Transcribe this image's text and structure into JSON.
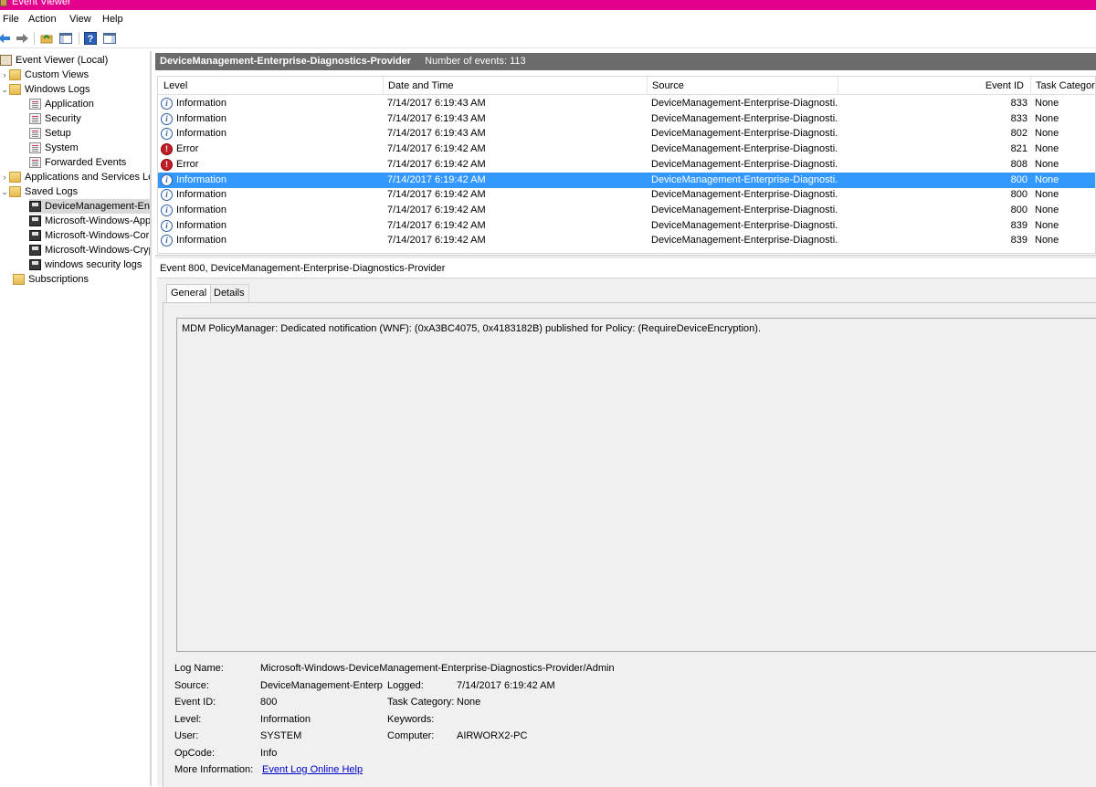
{
  "window": {
    "title": "Event Viewer"
  },
  "menu": [
    "File",
    "Action",
    "View",
    "Help"
  ],
  "toolbar": {
    "icons": [
      "back-arrow-icon",
      "forward-arrow-icon",
      "open-folder-icon",
      "show-hide-tree-icon",
      "help-icon",
      "show-action-pane-icon"
    ]
  },
  "tree": {
    "items": [
      {
        "label": "Event Viewer (Local)",
        "level": 0,
        "arrow": "",
        "icon": "root"
      },
      {
        "label": "Custom Views",
        "level": 0,
        "arrow": ">",
        "icon": "folder"
      },
      {
        "label": "Windows Logs",
        "level": 0,
        "arrow": "v",
        "icon": "folder"
      },
      {
        "label": "Application",
        "level": 1,
        "arrow": "",
        "icon": "log"
      },
      {
        "label": "Security",
        "level": 1,
        "arrow": "",
        "icon": "log"
      },
      {
        "label": "Setup",
        "level": 1,
        "arrow": "",
        "icon": "log"
      },
      {
        "label": "System",
        "level": 1,
        "arrow": "",
        "icon": "log"
      },
      {
        "label": "Forwarded Events",
        "level": 1,
        "arrow": "",
        "icon": "log"
      },
      {
        "label": "Applications and Services Lo",
        "level": 0,
        "arrow": ">",
        "icon": "folder"
      },
      {
        "label": "Saved Logs",
        "level": 0,
        "arrow": "v",
        "icon": "folder"
      },
      {
        "label": "DeviceManagement-Ente",
        "level": 1,
        "arrow": "",
        "icon": "saved",
        "selected": true
      },
      {
        "label": "Microsoft-Windows-App",
        "level": 1,
        "arrow": "",
        "icon": "saved"
      },
      {
        "label": "Microsoft-Windows-Cor",
        "level": 1,
        "arrow": "",
        "icon": "saved"
      },
      {
        "label": "Microsoft-Windows-Cryp",
        "level": 1,
        "arrow": "",
        "icon": "saved"
      },
      {
        "label": "windows security logs",
        "level": 1,
        "arrow": "",
        "icon": "saved"
      },
      {
        "label": "Subscriptions",
        "level": 0,
        "arrow": "",
        "icon": "sub"
      }
    ]
  },
  "log_header": {
    "title": "DeviceManagement-Enterprise-Diagnostics-Provider",
    "count": "Number of events: 113"
  },
  "grid": {
    "columns": [
      "Level",
      "Date and Time",
      "Source",
      "Event ID",
      "Task Category"
    ],
    "rows": [
      {
        "level": "Information",
        "type": "info",
        "date": "7/14/2017 6:19:43 AM",
        "source": "DeviceManagement-Enterprise-Diagnosti...",
        "id": "833",
        "cat": "None"
      },
      {
        "level": "Information",
        "type": "info",
        "date": "7/14/2017 6:19:43 AM",
        "source": "DeviceManagement-Enterprise-Diagnosti...",
        "id": "833",
        "cat": "None"
      },
      {
        "level": "Information",
        "type": "info",
        "date": "7/14/2017 6:19:43 AM",
        "source": "DeviceManagement-Enterprise-Diagnosti...",
        "id": "802",
        "cat": "None"
      },
      {
        "level": "Error",
        "type": "error",
        "date": "7/14/2017 6:19:42 AM",
        "source": "DeviceManagement-Enterprise-Diagnosti...",
        "id": "821",
        "cat": "None"
      },
      {
        "level": "Error",
        "type": "error",
        "date": "7/14/2017 6:19:42 AM",
        "source": "DeviceManagement-Enterprise-Diagnosti...",
        "id": "808",
        "cat": "None"
      },
      {
        "level": "Information",
        "type": "info",
        "date": "7/14/2017 6:19:42 AM",
        "source": "DeviceManagement-Enterprise-Diagnosti...",
        "id": "800",
        "cat": "None",
        "selected": true
      },
      {
        "level": "Information",
        "type": "info",
        "date": "7/14/2017 6:19:42 AM",
        "source": "DeviceManagement-Enterprise-Diagnosti...",
        "id": "800",
        "cat": "None"
      },
      {
        "level": "Information",
        "type": "info",
        "date": "7/14/2017 6:19:42 AM",
        "source": "DeviceManagement-Enterprise-Diagnosti...",
        "id": "800",
        "cat": "None"
      },
      {
        "level": "Information",
        "type": "info",
        "date": "7/14/2017 6:19:42 AM",
        "source": "DeviceManagement-Enterprise-Diagnosti...",
        "id": "839",
        "cat": "None"
      },
      {
        "level": "Information",
        "type": "info",
        "date": "7/14/2017 6:19:42 AM",
        "source": "DeviceManagement-Enterprise-Diagnosti...",
        "id": "839",
        "cat": "None"
      }
    ]
  },
  "detail": {
    "title": "Event 800, DeviceManagement-Enterprise-Diagnostics-Provider",
    "tabs": [
      "General",
      "Details"
    ],
    "message": "MDM PolicyManager: Dedicated notification (WNF): (0xA3BC4075, 0x4183182B) published for Policy: (RequireDeviceEncryption).",
    "labels": {
      "log_name": "Log Name:",
      "source": "Source:",
      "event_id": "Event ID:",
      "level": "Level:",
      "user": "User:",
      "opcode": "OpCode:",
      "more_info": "More Information:",
      "logged": "Logged:",
      "task_category": "Task Category:",
      "keywords": "Keywords:",
      "computer": "Computer:"
    },
    "values": {
      "log_name": "Microsoft-Windows-DeviceManagement-Enterprise-Diagnostics-Provider/Admin",
      "source": "DeviceManagement-Enterpr",
      "event_id": "800",
      "level": "Information",
      "user": "SYSTEM",
      "opcode": "Info",
      "more_info": "Event Log Online Help",
      "logged": "7/14/2017 6:19:42 AM",
      "task_category": "None",
      "keywords": "",
      "computer": "AIRWORX2-PC"
    }
  },
  "colors": {
    "title_bar": "#e3008c",
    "selection": "#3399ff",
    "header_bar": "#6b6b6b",
    "link": "#0000cc"
  }
}
